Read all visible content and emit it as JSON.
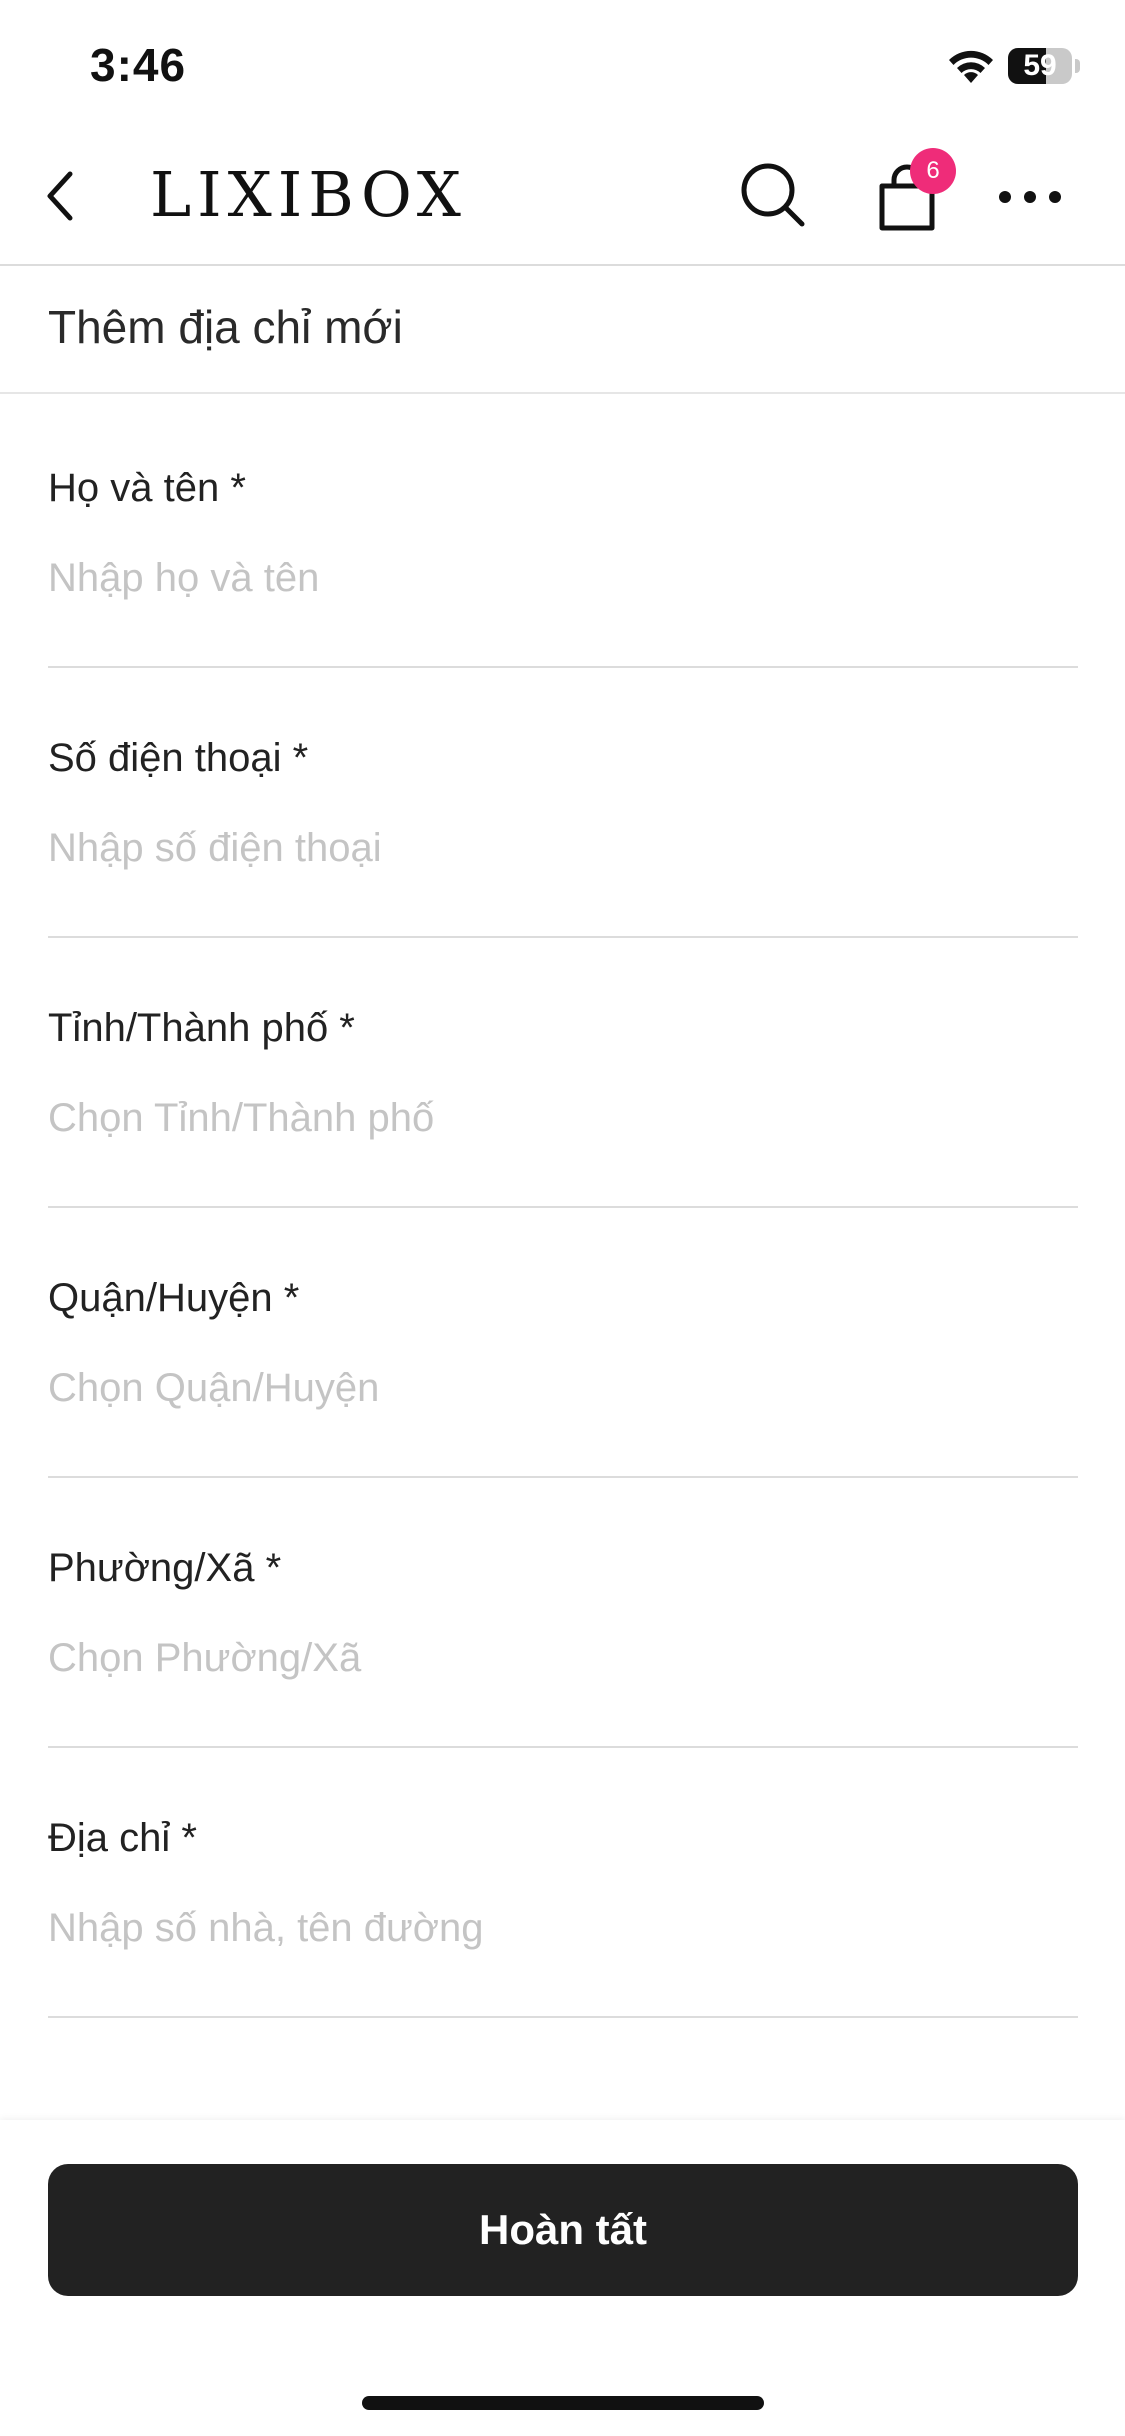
{
  "status_bar": {
    "time": "3:46",
    "battery_level": "59"
  },
  "header": {
    "logo": "LIXIBOX",
    "cart_count": "6",
    "icons": [
      "back-chevron-icon",
      "search-icon",
      "shopping-bag-icon",
      "more-dots-icon"
    ]
  },
  "page": {
    "title": "Thêm địa chỉ mới"
  },
  "form": {
    "fields": [
      {
        "label": "Họ và tên *",
        "placeholder": "Nhập họ và tên"
      },
      {
        "label": "Số điện thoại *",
        "placeholder": "Nhập số điện thoại"
      },
      {
        "label": "Tỉnh/Thành phố *",
        "placeholder": "Chọn Tỉnh/Thành phố"
      },
      {
        "label": "Quận/Huyện *",
        "placeholder": "Chọn Quận/Huyện"
      },
      {
        "label": "Phường/Xã *",
        "placeholder": "Chọn Phường/Xã"
      },
      {
        "label": "Địa chỉ *",
        "placeholder": "Nhập số nhà, tên đường"
      }
    ]
  },
  "actions": {
    "submit_label": "Hoàn tất"
  },
  "colors": {
    "accent_badge": "#ef2c79",
    "button_bg": "#222222",
    "placeholder": "#c4c4c4"
  }
}
